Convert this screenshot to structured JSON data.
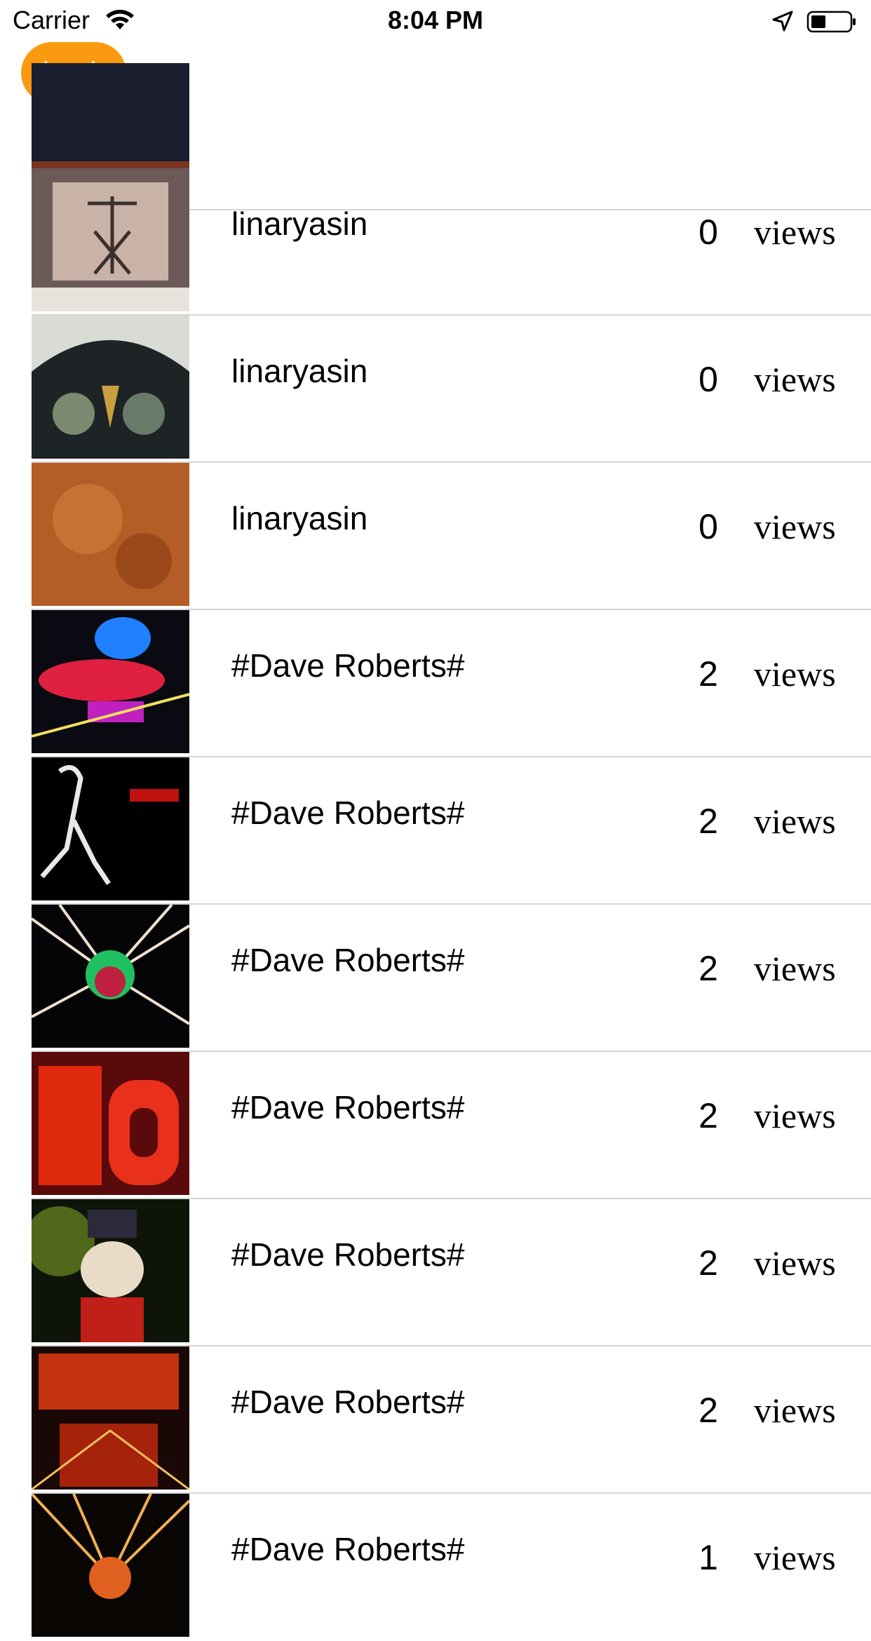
{
  "status_bar": {
    "carrier": "Carrier",
    "time": "8:04 PM"
  },
  "back_button": {
    "label": "back"
  },
  "rows": [
    {
      "author": "",
      "count": "",
      "views": ""
    },
    {
      "author": "linaryasin",
      "count": "0",
      "views": "views"
    },
    {
      "author": "linaryasin",
      "count": "0",
      "views": "views"
    },
    {
      "author": "linaryasin",
      "count": "0",
      "views": "views"
    },
    {
      "author": "#Dave Roberts#",
      "count": "2",
      "views": "views"
    },
    {
      "author": "#Dave Roberts#",
      "count": "2",
      "views": "views"
    },
    {
      "author": "#Dave Roberts#",
      "count": "2",
      "views": "views"
    },
    {
      "author": "#Dave Roberts#",
      "count": "2",
      "views": "views"
    },
    {
      "author": "#Dave Roberts#",
      "count": "2",
      "views": "views"
    },
    {
      "author": "#Dave Roberts#",
      "count": "2",
      "views": "views"
    },
    {
      "author": "#Dave Roberts#",
      "count": "1",
      "views": "views"
    }
  ]
}
